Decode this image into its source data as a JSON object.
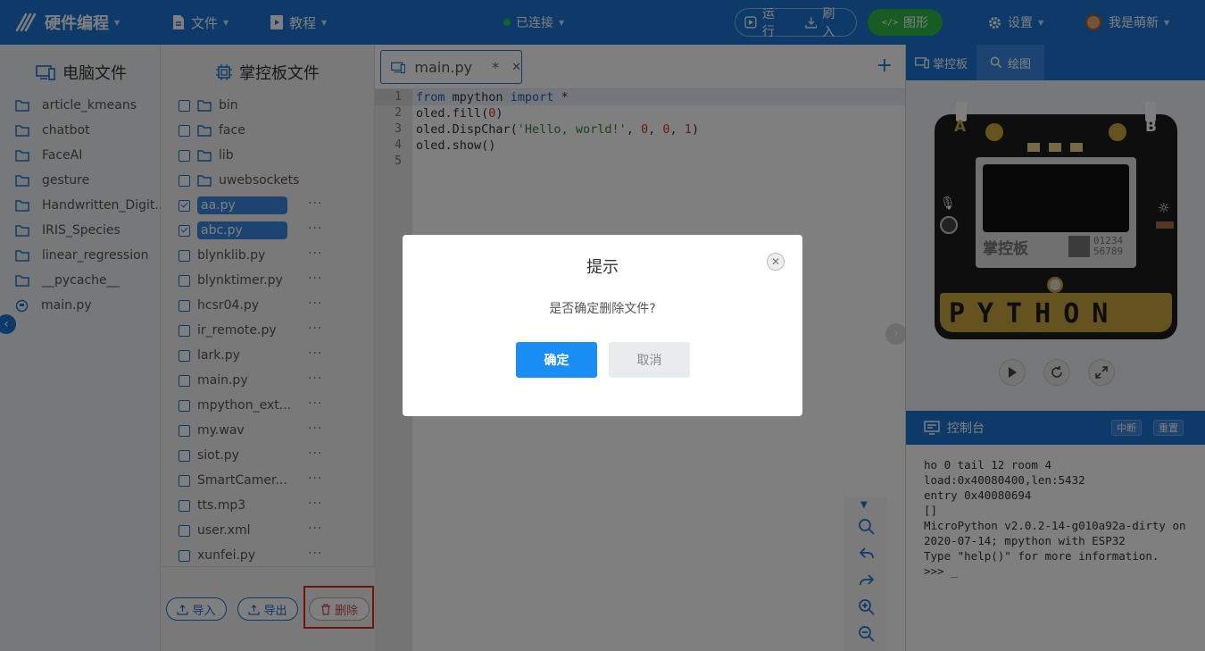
{
  "app": {
    "logo_text": "硬件编程",
    "menu_file": "文件",
    "menu_tutorial": "教程",
    "status": "已连接",
    "run": "运行",
    "flash": "刷入",
    "graph": "图形",
    "settings": "设置",
    "user": "我是萌新"
  },
  "colors": {
    "primary": "#1b74d0",
    "status_connected": "#19d04f",
    "graph_button": "#2fba47",
    "highlight_box": "#e3261b"
  },
  "pc_panel": {
    "title": "电脑文件",
    "items": [
      "article_kmeans",
      "chatbot",
      "FaceAI",
      "gesture",
      "Handwritten_Digit...",
      "IRIS_Species",
      "linear_regression",
      "__pycache__",
      "main.py"
    ]
  },
  "board_panel": {
    "title": "掌控板文件",
    "folders": [
      "bin",
      "face",
      "lib",
      "uwebsockets"
    ],
    "files": [
      {
        "name": "aa.py",
        "checked": true
      },
      {
        "name": "abc.py",
        "checked": true
      },
      {
        "name": "blynklib.py",
        "checked": false
      },
      {
        "name": "blynktimer.py",
        "checked": false
      },
      {
        "name": "hcsr04.py",
        "checked": false
      },
      {
        "name": "ir_remote.py",
        "checked": false
      },
      {
        "name": "lark.py",
        "checked": false
      },
      {
        "name": "main.py",
        "checked": false
      },
      {
        "name": "mpython_ext...",
        "checked": false
      },
      {
        "name": "my.wav",
        "checked": false
      },
      {
        "name": "siot.py",
        "checked": false
      },
      {
        "name": "SmartCamer...",
        "checked": false
      },
      {
        "name": "tts.mp3",
        "checked": false
      },
      {
        "name": "user.xml",
        "checked": false
      },
      {
        "name": "xunfei.py",
        "checked": false
      }
    ],
    "import": "导入",
    "export": "导出",
    "delete": "删除"
  },
  "editor": {
    "tab_name": "main.py",
    "modified_mark": "*",
    "line_numbers": [
      "1",
      "2",
      "3",
      "4",
      "5"
    ],
    "code": {
      "l1_kw1": "from",
      "l1_mod": " mpython ",
      "l1_kw2": "import",
      "l1_rest": " *",
      "l2_a": "oled.fill(",
      "l2_num": "0",
      "l2_b": ")",
      "l3_a": "oled.DispChar(",
      "l3_str": "'Hello, world!'",
      "l3_b": ", ",
      "l3_n1": "0",
      "l3_c": ", ",
      "l3_n2": "0",
      "l3_d": ", ",
      "l3_n3": "1",
      "l3_e": ")",
      "l4": "oled.show()"
    }
  },
  "right_panel": {
    "tab_board": "掌控板",
    "tab_draw": "绘图",
    "board_label_a": "A",
    "board_label_b": "B",
    "board_brand": "掌控板",
    "board_num1": "01234",
    "board_num2": "56789",
    "board_word": "PYTHON",
    "console_title": "控制台",
    "interrupt": "中断",
    "reset": "重置",
    "console_lines": [
      "ho 0 tail 12 room 4",
      "load:0x40080400,len:5432",
      "entry 0x40080694",
      "[]",
      "MicroPython v2.0.2-14-g010a92a-dirty on 2020-07-14; mpython with ESP32",
      "Type \"help()\" for more information.",
      ">>> _"
    ]
  },
  "dialog": {
    "title": "提示",
    "message": "是否确定删除文件?",
    "confirm": "确定",
    "cancel": "取消"
  }
}
